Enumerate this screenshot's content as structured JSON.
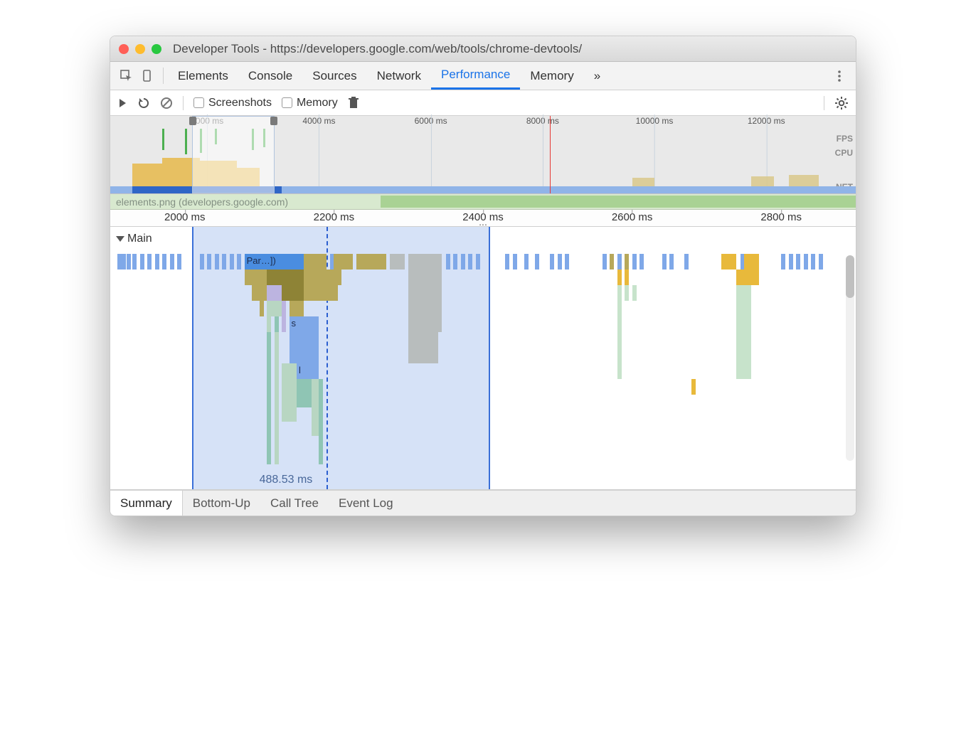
{
  "window": {
    "title": "Developer Tools - https://developers.google.com/web/tools/chrome-devtools/"
  },
  "tabs": {
    "items": [
      "Elements",
      "Console",
      "Sources",
      "Network",
      "Performance",
      "Memory"
    ],
    "overflow": "»",
    "active": "Performance"
  },
  "toolbar": {
    "screenshots_label": "Screenshots",
    "memory_label": "Memory"
  },
  "overview": {
    "ticks": [
      {
        "label": "2000 ms",
        "pct": 13
      },
      {
        "label": "4000 ms",
        "pct": 28
      },
      {
        "label": "6000 ms",
        "pct": 43
      },
      {
        "label": "8000 ms",
        "pct": 58
      },
      {
        "label": "10000 ms",
        "pct": 73
      },
      {
        "label": "12000 ms",
        "pct": 88
      }
    ],
    "fps_label": "FPS",
    "cpu_label": "CPU",
    "net_label": "NET",
    "selection_start_pct": 11,
    "selection_end_pct": 22,
    "redline_pct": 59
  },
  "netstrip": {
    "filename": "elements.png (developers.google.com)"
  },
  "ruler": {
    "ticks": [
      {
        "label": "2000 ms",
        "pct": 10
      },
      {
        "label": "2200 ms",
        "pct": 30
      },
      {
        "label": "2400 ms",
        "pct": 50
      },
      {
        "label": "2600 ms",
        "pct": 70
      },
      {
        "label": "2800 ms",
        "pct": 90
      }
    ],
    "collapse": "..."
  },
  "flame": {
    "main_label": "Main",
    "selection_start_pct": 11,
    "selection_end_pct": 51,
    "cursor_pct": 29,
    "selection_duration": "488.53 ms",
    "block_parse": "Par…])",
    "block_s": "s",
    "block_l": "l"
  },
  "bottom_tabs": {
    "items": [
      "Summary",
      "Bottom-Up",
      "Call Tree",
      "Event Log"
    ],
    "active": "Summary"
  }
}
